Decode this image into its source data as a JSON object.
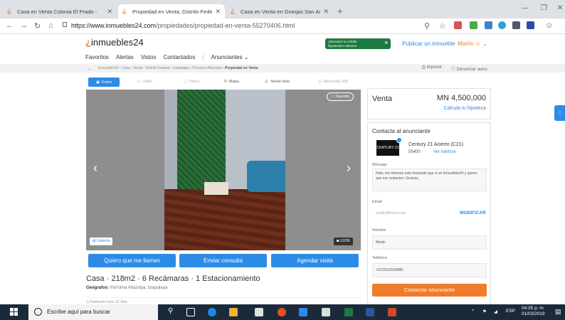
{
  "browser": {
    "tabs": [
      {
        "title": "Casa en Venta Colonia El Prado - ",
        "active": false
      },
      {
        "title": "Propiedad en Venta, Distrito Fede",
        "active": true
      },
      {
        "title": "Casa en Venta en Granjas San An",
        "active": false
      }
    ],
    "new_tab": "+",
    "url_host": "https://www.inmuebles24.com",
    "url_path": "/propiedades/propiedad-en-venta-55270406.html"
  },
  "header": {
    "logo": "inmuebles24",
    "nav": [
      "Favoritos",
      "Alertas",
      "Vistos",
      "Contactados",
      "Anunciantes ⌄"
    ],
    "promo_line1": "¡Descubre tu crédito",
    "promo_line2": "hipotecario máximo!",
    "publish": "Publicar un inmueble",
    "user": "Martín ☺ ⌄"
  },
  "breadcrumb": {
    "path": "Inmuebles24 › Casa › Venta › Distrito Federal › Iztapalapa › Purísima Atlazolpa ›",
    "current": "Propiedad en Venta",
    "print": "Imprimir",
    "report": "Denunciar aviso"
  },
  "media_tabs": [
    "Fotos",
    "Video",
    "Plano",
    "Mapa",
    "Street view",
    "Recorrido 360"
  ],
  "gallery": {
    "favorite": "♡ Favorito",
    "galeria": "Galería",
    "counter": "12/36"
  },
  "actions": [
    "Quiero que me llamen",
    "Enviar consulta",
    "Agendar visita"
  ],
  "property": {
    "summary": "Casa · 218m2 · 6 Recámaras · 1 Estacionamiento",
    "geo_label": "Geógrafos:",
    "geo_value": "Purísima Atlazolpa, Iztapalapa",
    "published": "Publicado hace 31 días"
  },
  "price_card": {
    "operation": "Venta",
    "price": "MN 4,500,000",
    "mortgage_link": "Calcula tu hipoteca"
  },
  "contact": {
    "title": "Contacta al anunciante",
    "agency_logo": "CENTURY 21",
    "agency_name": "Century 21 Acierto (C21)",
    "phone_partial": "55400",
    "phone_link": "Ver teléfono",
    "message_label": "Mensaje",
    "message_value": "Hola, me interesa este inmueble que vi en Inmuebles24 y quiero que me contacten. Gracias.",
    "email_label": "Email",
    "email_value": "martin@finders.mx",
    "email_action": "MODIFICAR",
    "name_label": "Nombre",
    "name_value": "Martin",
    "phone_label": "Teléfono",
    "phone_value": "+5215513334881",
    "cta": "Contactar anunciante"
  },
  "taskbar": {
    "search": "Escribe aquí para buscar",
    "lang": "ESP",
    "time": "04:35 p. m.",
    "date": "01/03/2019"
  },
  "colors": {
    "accent_orange": "#f07c2c",
    "accent_blue": "#2d8be8",
    "promo_green": "#1d7a3e"
  }
}
